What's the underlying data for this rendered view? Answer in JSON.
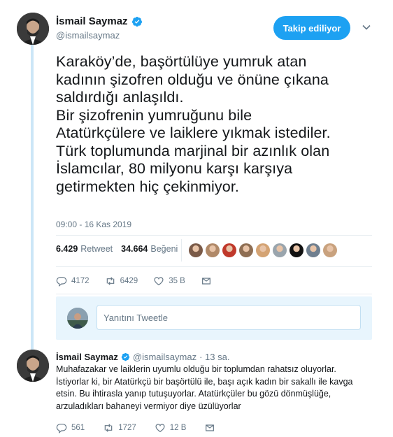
{
  "tweet": {
    "author_name": "İsmail Saymaz",
    "author_handle": "@ismailsaymaz",
    "follow_label": "Takip ediliyor",
    "text": "Karaköy’de, başörtülüye yumruk atan\nkadının şizofren olduğu ve önüne çıkana\nsaldırdığı anlaşıldı.\nBir şizofrenin yumruğunu bile\nAtatürkçülere ve laiklere yıkmak istediler.\nTürk toplumunda marjinal bir azınlık olan\nİslamcılar, 80 milyonu karşı karşıya\ngetirmekten hiç çekinmiyor.",
    "timestamp": "09:00 - 16 Kas 2019",
    "retweet_count": "6.429",
    "retweet_label": "Retweet",
    "like_count": "34.664",
    "like_label": "Beğeni",
    "liker_colors": [
      "#7a5a48",
      "#b08968",
      "#c0392b",
      "#8e6e53",
      "#d4a373",
      "#9aa5ad",
      "#111111",
      "#6f7f8f",
      "#c9a27e"
    ],
    "actions": {
      "reply_count": "4172",
      "retweet_count": "6429",
      "like_count": "35 B"
    }
  },
  "reply_box": {
    "placeholder": "Yanıtını Tweetle"
  },
  "reply_tweet": {
    "author_name": "İsmail Saymaz",
    "author_handle": "@ismailsaymaz",
    "time": "· 13 sa.",
    "text": "Muhafazakar ve laiklerin uyumlu olduğu bir toplumdan rahatsız oluyorlar.\nİstiyorlar ki, bir Atatürkçü bir başörtülü ile, başı açık kadın bir sakallı ile kavga\netsin. Bu ihtirasla yanıp tutuşuyorlar. Atatürkçüler bu gözü dönmüşlüğe,\narzuladıkları bahaneyi vermiyor diye üzülüyorlar",
    "actions": {
      "reply_count": "561",
      "retweet_count": "1727",
      "like_count": "12 B"
    }
  },
  "colors": {
    "accent": "#1da1f2",
    "muted": "#657786",
    "thread_line": "#cce6f7"
  }
}
